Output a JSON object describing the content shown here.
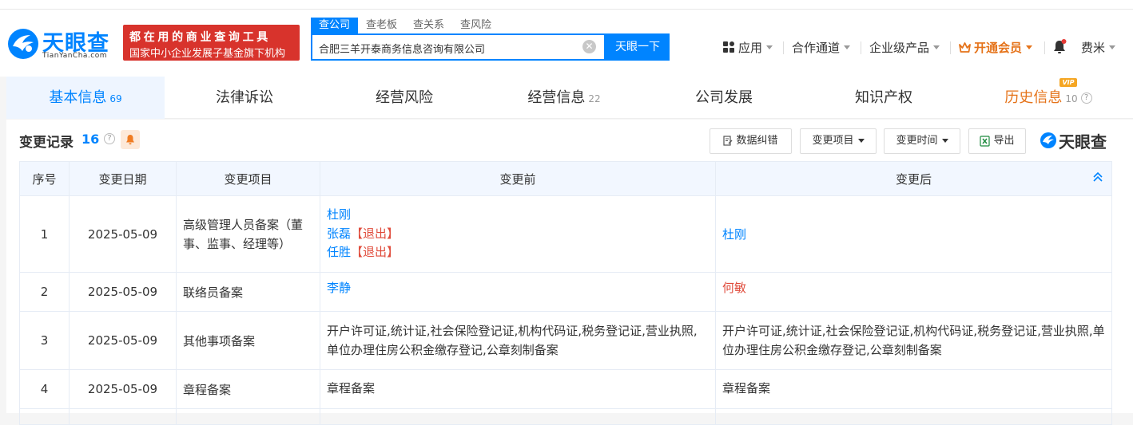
{
  "header": {
    "logo_text": "天眼查",
    "logo_sub": "TianYanCha.com",
    "slogan_line1": "都在用的商业查询工具",
    "slogan_line2": "国家中小企业发展子基金旗下机构",
    "search_tabs": [
      "查公司",
      "查老板",
      "查关系",
      "查风险"
    ],
    "search_value": "合肥三羊开泰商务信息咨询有限公司",
    "search_button": "天眼一下",
    "nav": {
      "apps": "应用",
      "channels": "合作通道",
      "enterprise": "企业级产品",
      "vip": "开通会员",
      "user": "费米"
    },
    "brand_color": "#0084ff"
  },
  "tabs": [
    {
      "label": "基本信息",
      "count": "69"
    },
    {
      "label": "法律诉讼",
      "count": ""
    },
    {
      "label": "经营风险",
      "count": ""
    },
    {
      "label": "经营信息",
      "count": "22"
    },
    {
      "label": "公司发展",
      "count": ""
    },
    {
      "label": "知识产权",
      "count": ""
    },
    {
      "label": "历史信息",
      "count": "10",
      "badge": "VIP"
    }
  ],
  "section": {
    "title": "变更记录",
    "count": "16",
    "buttons": {
      "correction": "数据纠错",
      "change_item": "变更项目",
      "change_time": "变更时间",
      "export": "导出"
    },
    "brand": "天眼查"
  },
  "table": {
    "headers": [
      "序号",
      "变更日期",
      "变更项目",
      "变更前",
      "变更后"
    ],
    "rows": [
      {
        "no": "1",
        "date": "2025-05-09",
        "item": "高级管理人员备案（董事、监事、经理等）",
        "before": [
          {
            "name": "杜刚",
            "tag": ""
          },
          {
            "name": "张磊",
            "tag": "【退出】"
          },
          {
            "name": "任胜",
            "tag": "【退出】"
          }
        ],
        "after": "杜刚"
      },
      {
        "no": "2",
        "date": "2025-05-09",
        "item": "联络员备案",
        "before_text": "李静",
        "after": "何敏"
      },
      {
        "no": "3",
        "date": "2025-05-09",
        "item": "其他事项备案",
        "before_text": "开户许可证,统计证,社会保险登记证,机构代码证,税务登记证,营业执照,单位办理住房公积金缴存登记,公章刻制备案",
        "after": "开户许可证,统计证,社会保险登记证,机构代码证,税务登记证,营业执照,单位办理住房公积金缴存登记,公章刻制备案"
      },
      {
        "no": "4",
        "date": "2025-05-09",
        "item": "章程备案",
        "before_text": "章程备案",
        "after": "章程备案"
      }
    ]
  }
}
